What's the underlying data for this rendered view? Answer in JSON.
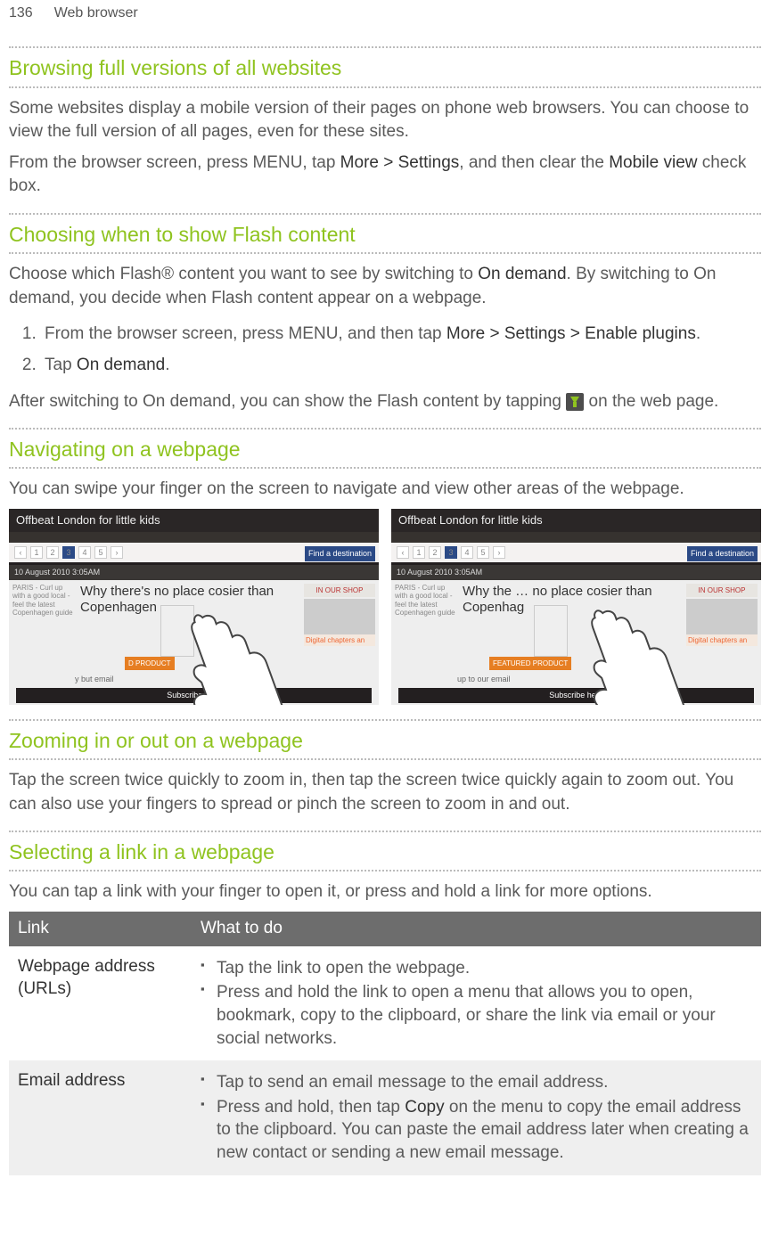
{
  "header": {
    "page_number": "136",
    "section": "Web browser"
  },
  "sections": [
    {
      "heading": "Browsing full versions of all websites",
      "paragraphs": [
        "Some websites display a mobile version of their pages on phone web browsers. You can choose to view the full version of all pages, even for these sites.",
        "From the browser screen, press MENU, tap {b}More > Settings{/b}, and then clear the {b}Mobile view{/b} check box."
      ]
    },
    {
      "heading": "Choosing when to show Flash content",
      "paragraphs": [
        "Choose which Flash® content you want to see by switching to {b}On demand{/b}. By switching to On demand, you decide when Flash content appear on a webpage."
      ],
      "steps": [
        "From the browser screen, press MENU, and then tap {b}More > Settings > Enable plugins{/b}.",
        "Tap {b}On demand{/b}."
      ],
      "after": "After switching to On demand, you can show the Flash content by tapping {icon} on the web page."
    },
    {
      "heading": "Navigating on a webpage",
      "paragraphs": [
        "You can swipe your finger on the screen to navigate and view other areas of the webpage."
      ],
      "screenshot": {
        "title": "Offbeat London for little kids",
        "date": "10 August 2010 3:05AM",
        "headline_a": "Why there's no place cosier than Copenhagen",
        "headline_b": "Why the … no place cosier than Copenhag",
        "shop": "IN OUR SHOP",
        "chapters": "Digital chapters an",
        "product_a": "D PRODUCT",
        "product_b": "FEATURED PRODUCT",
        "email_a": "y but email",
        "email_b": "up to our email",
        "dest": "Find a destination",
        "left_blurb": "PARIS - Curl up with a good local - feel the latest Copenhagen guide",
        "subscribe": "Subscribe here"
      }
    },
    {
      "heading": "Zooming in or out on a webpage",
      "paragraphs": [
        "Tap the screen twice quickly to zoom in, then tap the screen twice quickly again to zoom out. You can also use your fingers to spread or pinch the screen to zoom in and out."
      ]
    },
    {
      "heading": "Selecting a link in a webpage",
      "paragraphs": [
        "You can tap a link with your finger to open it, or press and hold a link for more options."
      ],
      "table": {
        "headers": [
          "Link",
          "What to do"
        ],
        "rows": [
          {
            "name": "Webpage address (URLs)",
            "items": [
              "Tap the link to open the webpage.",
              "Press and hold the link to open a menu that allows you to open, bookmark, copy to the clipboard, or share the link via email or your social networks."
            ]
          },
          {
            "name": "Email address",
            "items": [
              "Tap to send an email message to the email address.",
              "Press and hold, then tap {b}Copy{/b} on the menu to copy the email address to the clipboard. You can paste the email address later when creating a new contact or sending a new email message."
            ]
          }
        ]
      }
    }
  ]
}
